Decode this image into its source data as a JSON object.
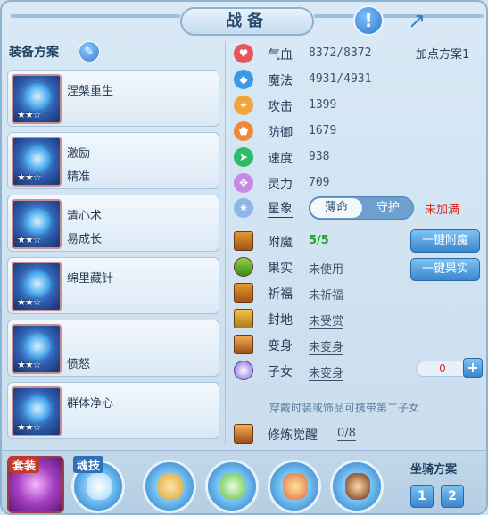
{
  "window": {
    "title": "战备"
  },
  "left": {
    "title": "装备方案",
    "plans": [
      {
        "line1": "涅槃重生",
        "line2": "",
        "stars": "★★☆"
      },
      {
        "line1": "激励",
        "line2": "精准",
        "stars": "★★☆"
      },
      {
        "line1": "清心术",
        "line2": "易成长",
        "stars": "★★☆"
      },
      {
        "line1": "绵里藏针",
        "line2": "",
        "stars": "★★☆"
      },
      {
        "line1": "",
        "line2": "愤怒",
        "stars": "★★☆"
      },
      {
        "line1": "群体净心",
        "line2": "",
        "stars": "★★☆"
      }
    ]
  },
  "stats": {
    "add_scheme": "加点方案1",
    "rows": [
      {
        "label": "气血",
        "value": "8372/8372",
        "icon": "heart-icon",
        "color": "#e8545b"
      },
      {
        "label": "魔法",
        "value": "4931/4931",
        "icon": "diamond-icon",
        "color": "#3b9ae8"
      },
      {
        "label": "攻击",
        "value": "1399",
        "icon": "attack-icon",
        "color": "#f2a43a"
      },
      {
        "label": "防御",
        "value": "1679",
        "icon": "shield-icon",
        "color": "#f0883a"
      },
      {
        "label": "速度",
        "value": "938",
        "icon": "speed-icon",
        "color": "#2bbd68"
      },
      {
        "label": "灵力",
        "value": "709",
        "icon": "spirit-icon",
        "color": "#c38ae6"
      }
    ],
    "star": {
      "label": "星象",
      "on": "薄命",
      "off": "守护",
      "status": "未加满"
    }
  },
  "extra": {
    "rows": [
      {
        "label": "附魔",
        "value": "5/5",
        "style": "green"
      },
      {
        "label": "果实",
        "value": "未使用",
        "style": ""
      },
      {
        "label": "祈福",
        "value": "未祈福",
        "style": "u"
      },
      {
        "label": "封地",
        "value": "未受赏",
        "style": "u"
      },
      {
        "label": "变身",
        "value": "未变身",
        "style": "u"
      },
      {
        "label": "子女",
        "value": "未变身",
        "style": "u"
      }
    ],
    "btn_enchant": "一键附魔",
    "btn_fruit": "一键果实",
    "child_value": "0",
    "plus": "+",
    "hint": "穿戴时装或饰品可携带第二子女",
    "cultivate_label": "修炼觉醒",
    "cultivate_value": "0/8"
  },
  "bottom": {
    "suit_label": "套装",
    "soul_label": "魂技",
    "mount_title": "坐骑方案",
    "mount_1": "1",
    "mount_2": "2"
  },
  "top": {
    "alert": "!",
    "share": "↗"
  }
}
